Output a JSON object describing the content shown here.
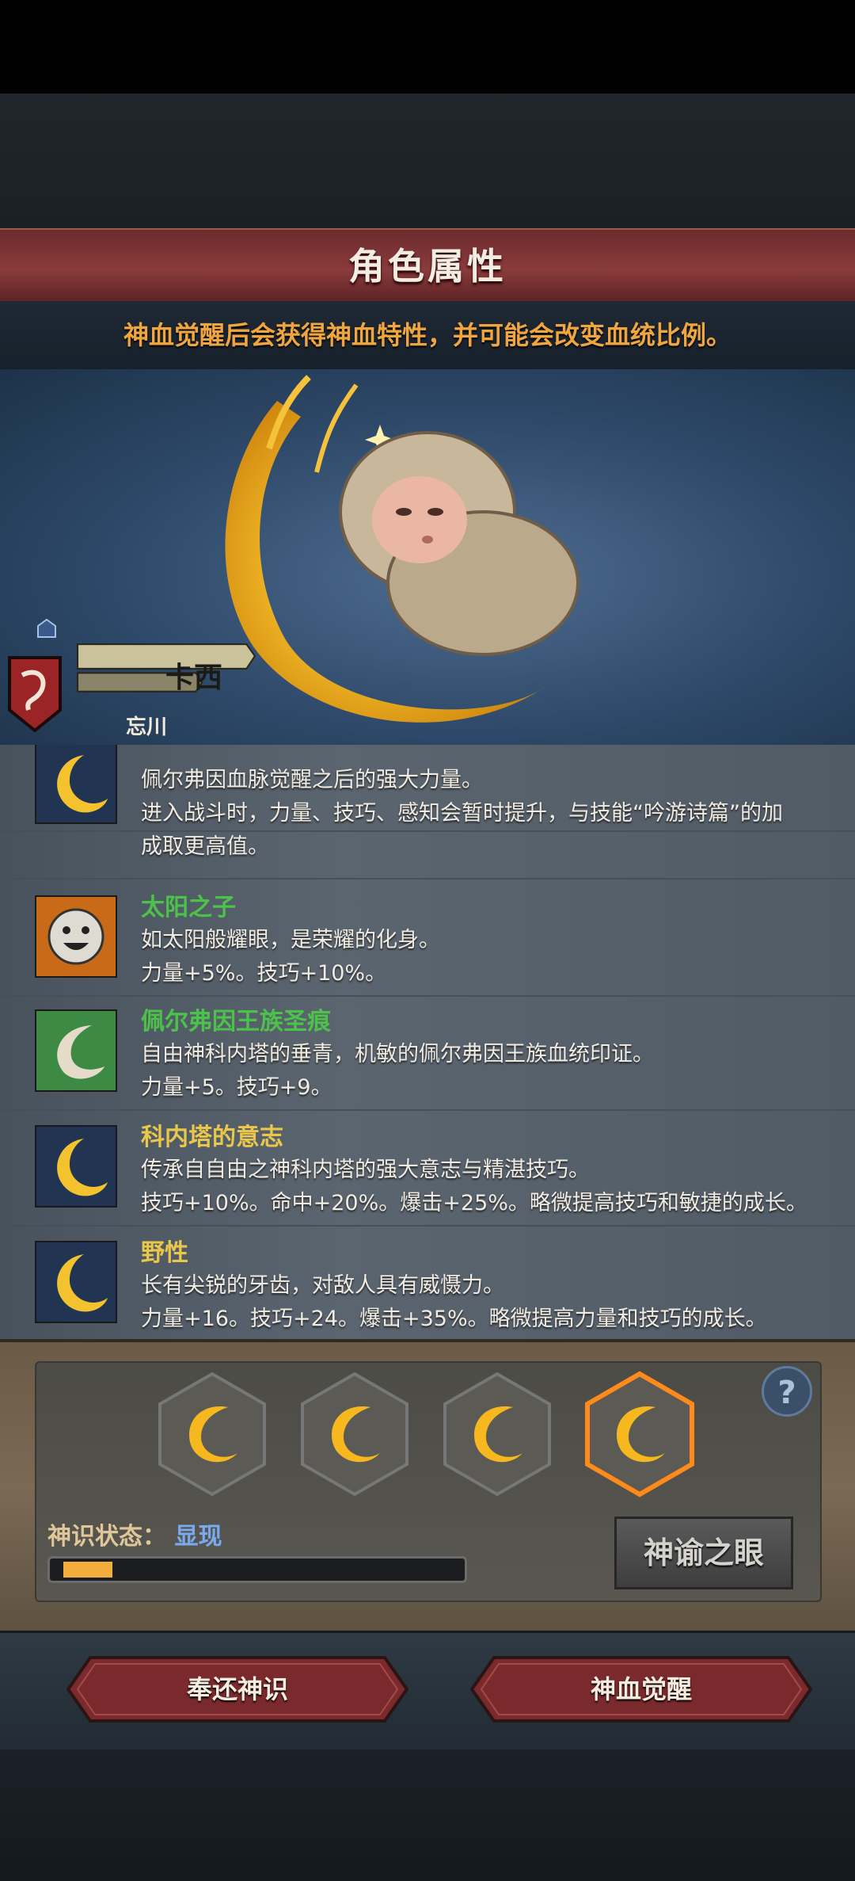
{
  "header": {
    "title": "角色属性",
    "subtitle": "神血觉醒后会获得神血特性，并可能会改变血统比例。"
  },
  "character": {
    "name": "卡西",
    "subname": "忘川"
  },
  "traits": [
    {
      "name": "",
      "icon": "crescent-moon-icon",
      "lines": [
        "佩尔弗因血脉觉醒之后的强大力量。",
        "进入战斗时，力量、技巧、感知会暂时提升，与技能“吟游诗篇”的加",
        "成取更高值。"
      ]
    },
    {
      "name": "太阳之子",
      "icon": "sun-face-icon",
      "lines": [
        "如太阳般耀眼，是荣耀的化身。",
        "力量+5%。技巧+10%。"
      ]
    },
    {
      "name": "佩尔弗因王族圣痕",
      "icon": "royal-mark-icon",
      "lines": [
        "自由神科内塔的垂青，机敏的佩尔弗因王族血统印证。",
        "力量+5。技巧+9。"
      ]
    },
    {
      "name": "科内塔的意志",
      "icon": "crescent-moon-icon",
      "lines": [
        "传承自自由之神科内塔的强大意志与精湛技巧。",
        "技巧+10%。命中+20%。爆击+25%。略微提高技巧和敏捷的成长。"
      ]
    },
    {
      "name": "野性",
      "icon": "crescent-moon-icon",
      "lines": [
        "长有尖锐的牙齿，对敌人具有威慑力。",
        "力量+16。技巧+24。爆击+35%。略微提高力量和技巧的成长。"
      ]
    }
  ],
  "divine_sense": {
    "label": "神识状态：",
    "value": "显现",
    "progress": 0.1,
    "oracle_button": "神谕之眼",
    "help": "?"
  },
  "actions": {
    "return_label": "奉还神识",
    "awaken_label": "神血觉醒"
  },
  "colors": {
    "accent_orange": "#f0a640",
    "trait_green": "#4cc24a",
    "trait_yellow": "#e8c74a",
    "status_blue": "#79aaf0"
  }
}
